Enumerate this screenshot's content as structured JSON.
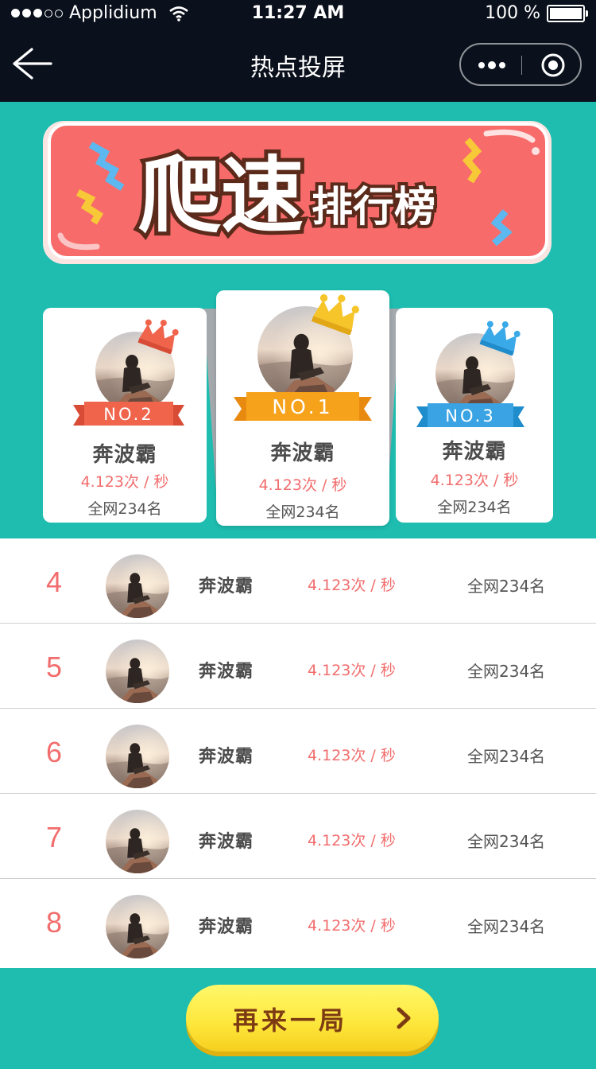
{
  "status_bar": {
    "carrier": "Applidium",
    "time": "11:27 AM",
    "battery": "100 %"
  },
  "nav": {
    "title": "热点投屏",
    "back_icon": "back-arrow-icon",
    "more_icon": "more-dots-icon",
    "close_icon": "target-circle-icon"
  },
  "banner": {
    "title": "爬速",
    "subtitle": "排行榜"
  },
  "podium": [
    {
      "badge": "NO.2",
      "name": "奔波霸",
      "speed": "4.123次 / 秒",
      "rank": "全网234名",
      "crown_color": "#f0644c",
      "ribbon_color": "#f0644c"
    },
    {
      "badge": "NO.1",
      "name": "奔波霸",
      "speed": "4.123次 / 秒",
      "rank": "全网234名",
      "crown_color": "#f6c52a",
      "ribbon_color": "#f7a21b"
    },
    {
      "badge": "NO.3",
      "name": "奔波霸",
      "speed": "4.123次 / 秒",
      "rank": "全网234名",
      "crown_color": "#3aa9e8",
      "ribbon_color": "#3aa3e3"
    }
  ],
  "list": [
    {
      "rank_no": "4",
      "name": "奔波霸",
      "speed": "4.123次 / 秒",
      "rank": "全网234名"
    },
    {
      "rank_no": "5",
      "name": "奔波霸",
      "speed": "4.123次 / 秒",
      "rank": "全网234名"
    },
    {
      "rank_no": "6",
      "name": "奔波霸",
      "speed": "4.123次 / 秒",
      "rank": "全网234名"
    },
    {
      "rank_no": "7",
      "name": "奔波霸",
      "speed": "4.123次 / 秒",
      "rank": "全网234名"
    },
    {
      "rank_no": "8",
      "name": "奔波霸",
      "speed": "4.123次 / 秒",
      "rank": "全网234名"
    }
  ],
  "action": {
    "again_label": "再来一局"
  },
  "colors": {
    "background": "#1ebdb0",
    "nav_bg": "#0b111c",
    "accent_red": "#f26d6d",
    "button_yellow": "#fde63a"
  }
}
